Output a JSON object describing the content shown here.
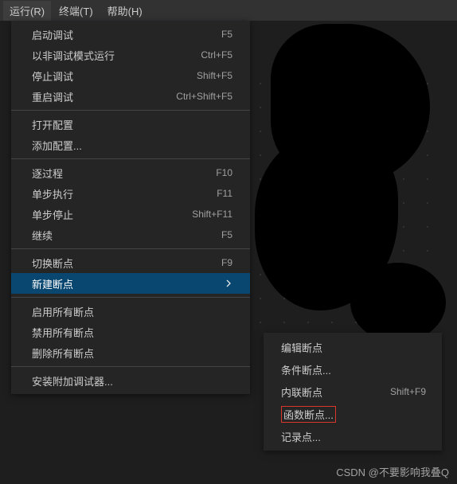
{
  "menubar": {
    "run": "运行(R)",
    "terminal": "终端(T)",
    "help": "帮助(H)"
  },
  "menu": {
    "start_debugging": "启动调试",
    "start_debugging_key": "F5",
    "run_without_debugging": "以非调试模式运行",
    "run_without_debugging_key": "Ctrl+F5",
    "stop_debugging": "停止调试",
    "stop_debugging_key": "Shift+F5",
    "restart_debugging": "重启调试",
    "restart_debugging_key": "Ctrl+Shift+F5",
    "open_config": "打开配置",
    "add_config": "添加配置...",
    "step_over": "逐过程",
    "step_over_key": "F10",
    "step_into": "单步执行",
    "step_into_key": "F11",
    "step_out": "单步停止",
    "step_out_key": "Shift+F11",
    "continue": "继续",
    "continue_key": "F5",
    "toggle_breakpoint": "切换断点",
    "toggle_breakpoint_key": "F9",
    "new_breakpoint": "新建断点",
    "enable_all": "启用所有断点",
    "disable_all": "禁用所有断点",
    "remove_all": "删除所有断点",
    "install_debuggers": "安装附加调试器..."
  },
  "submenu": {
    "edit_breakpoint": "编辑断点",
    "conditional_breakpoint": "条件断点...",
    "inline_breakpoint": "内联断点",
    "inline_breakpoint_key": "Shift+F9",
    "function_breakpoint": "函数断点...",
    "logpoint": "记录点..."
  },
  "watermark": "CSDN @不要影响我叠Q"
}
